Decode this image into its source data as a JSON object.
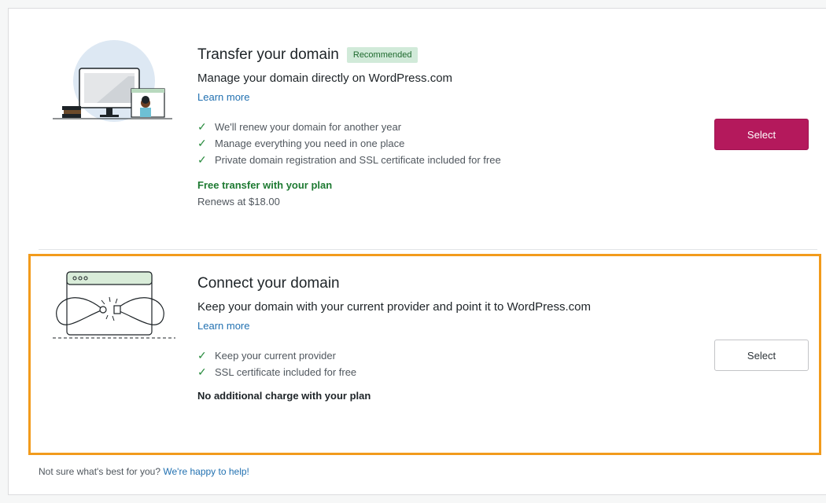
{
  "options": [
    {
      "title": "Transfer your domain",
      "badge": "Recommended",
      "subtitle": "Manage your domain directly on WordPress.com",
      "learn_more": "Learn more",
      "features": [
        "We'll renew your domain for another year",
        "Manage everything you need in one place",
        "Private domain registration and SSL certificate included for free"
      ],
      "price_note": "Free transfer with your plan",
      "renew_note": "Renews at $18.00",
      "button_label": "Select",
      "illustration_icon": "computer-desk-illustration"
    },
    {
      "title": "Connect your domain",
      "subtitle": "Keep your domain with your current provider and point it to WordPress.com",
      "learn_more": "Learn more",
      "features": [
        "Keep your current provider",
        "SSL certificate included for free"
      ],
      "price_note": "No additional charge with your plan",
      "button_label": "Select",
      "illustration_icon": "plug-connect-illustration"
    }
  ],
  "help": {
    "text": "Not sure what's best for you?",
    "link": "We're happy to help!"
  },
  "colors": {
    "primary_button": "#b4195c",
    "highlight_border": "#f29b1c",
    "link": "#2271b1",
    "check": "#2a8c3f",
    "badge_bg": "#d1ead9"
  }
}
